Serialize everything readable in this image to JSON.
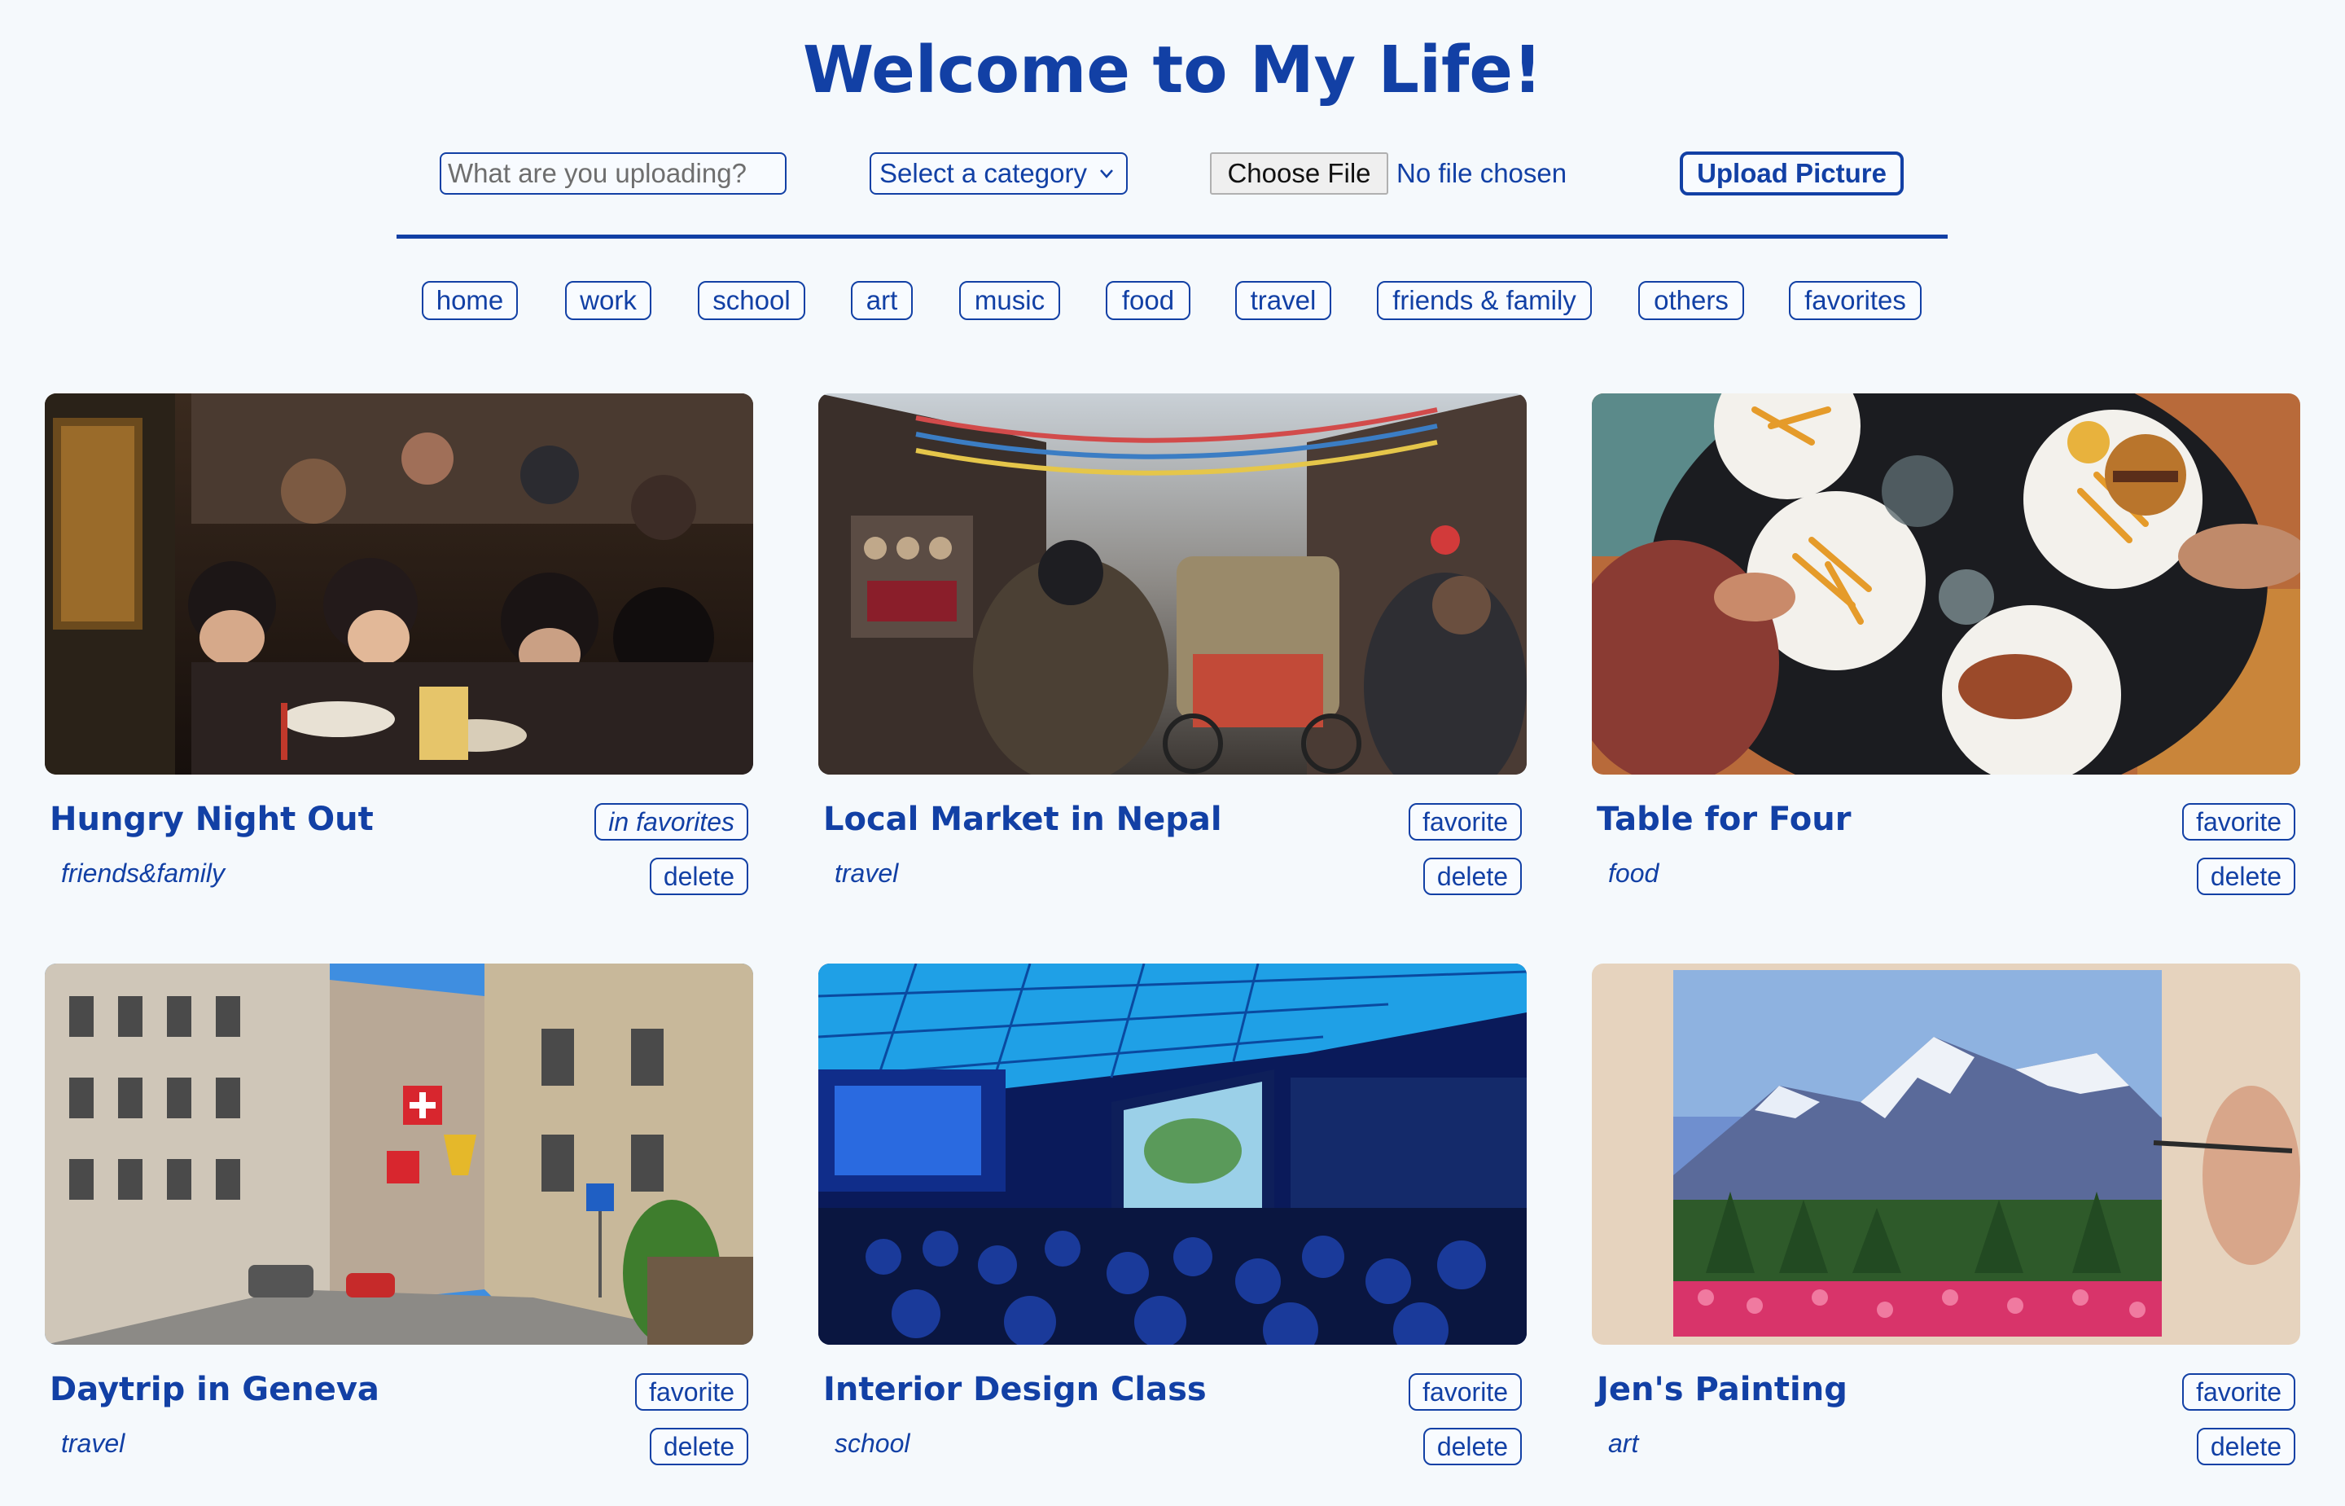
{
  "header": {
    "title": "Welcome to My Life!"
  },
  "upload_form": {
    "caption_placeholder": "What are you uploading?",
    "category_select": "Select a category",
    "file_button": "Choose File",
    "file_status": "No file chosen",
    "submit_label": "Upload Picture"
  },
  "nav": {
    "items": [
      {
        "label": "home"
      },
      {
        "label": "work"
      },
      {
        "label": "school"
      },
      {
        "label": "art"
      },
      {
        "label": "music"
      },
      {
        "label": "food"
      },
      {
        "label": "travel"
      },
      {
        "label": "friends & family"
      },
      {
        "label": "others"
      },
      {
        "label": "favorites"
      }
    ]
  },
  "cards": [
    {
      "title": "Hungry Night Out",
      "category": "friends&family",
      "favorite_label": "in favorites",
      "is_favorite": true,
      "delete_label": "delete",
      "image": "people-eating-noodles-photo"
    },
    {
      "title": "Local Market in Nepal",
      "category": "travel",
      "favorite_label": "favorite",
      "is_favorite": false,
      "delete_label": "delete",
      "image": "nepal-street-market-photo"
    },
    {
      "title": "Table for Four",
      "category": "food",
      "favorite_label": "favorite",
      "is_favorite": false,
      "delete_label": "delete",
      "image": "table-with-burgers-and-fries-photo"
    },
    {
      "title": "Daytrip in Geneva",
      "category": "travel",
      "favorite_label": "favorite",
      "is_favorite": false,
      "delete_label": "delete",
      "image": "geneva-street-photo"
    },
    {
      "title": "Interior Design Class",
      "category": "school",
      "favorite_label": "favorite",
      "is_favorite": false,
      "delete_label": "delete",
      "image": "lecture-hall-photo"
    },
    {
      "title": "Jen's Painting",
      "category": "art",
      "favorite_label": "favorite",
      "is_favorite": false,
      "delete_label": "delete",
      "image": "mountain-painting-photo"
    }
  ],
  "colors": {
    "accent": "#1240a5",
    "background": "#f5f9fc"
  }
}
